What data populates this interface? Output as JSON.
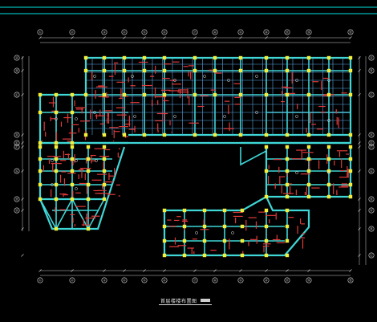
{
  "drawing": {
    "title": "首层楼楼布置图",
    "background": "#000000",
    "colors": {
      "frame": "#00e5e5",
      "wall": "#3fd6d6",
      "beam": "#5aa6e6",
      "column": "#f2ee3a",
      "rebar": "#e23a3a",
      "dimension": "#d0d0d0",
      "axis_bubble": "#d8d8d8"
    },
    "axis_labels_top": [
      "①",
      "②",
      "③",
      "④",
      "⑤",
      "⑥",
      "⑦",
      "⑧",
      "⑨",
      "⑩",
      "⑪",
      "⑫",
      "⑬"
    ],
    "axis_labels_left": [
      "Ⓐ",
      "Ⓑ",
      "Ⓒ",
      "Ⓓ",
      "Ⓔ",
      "Ⓕ",
      "Ⓖ",
      "Ⓗ"
    ]
  }
}
